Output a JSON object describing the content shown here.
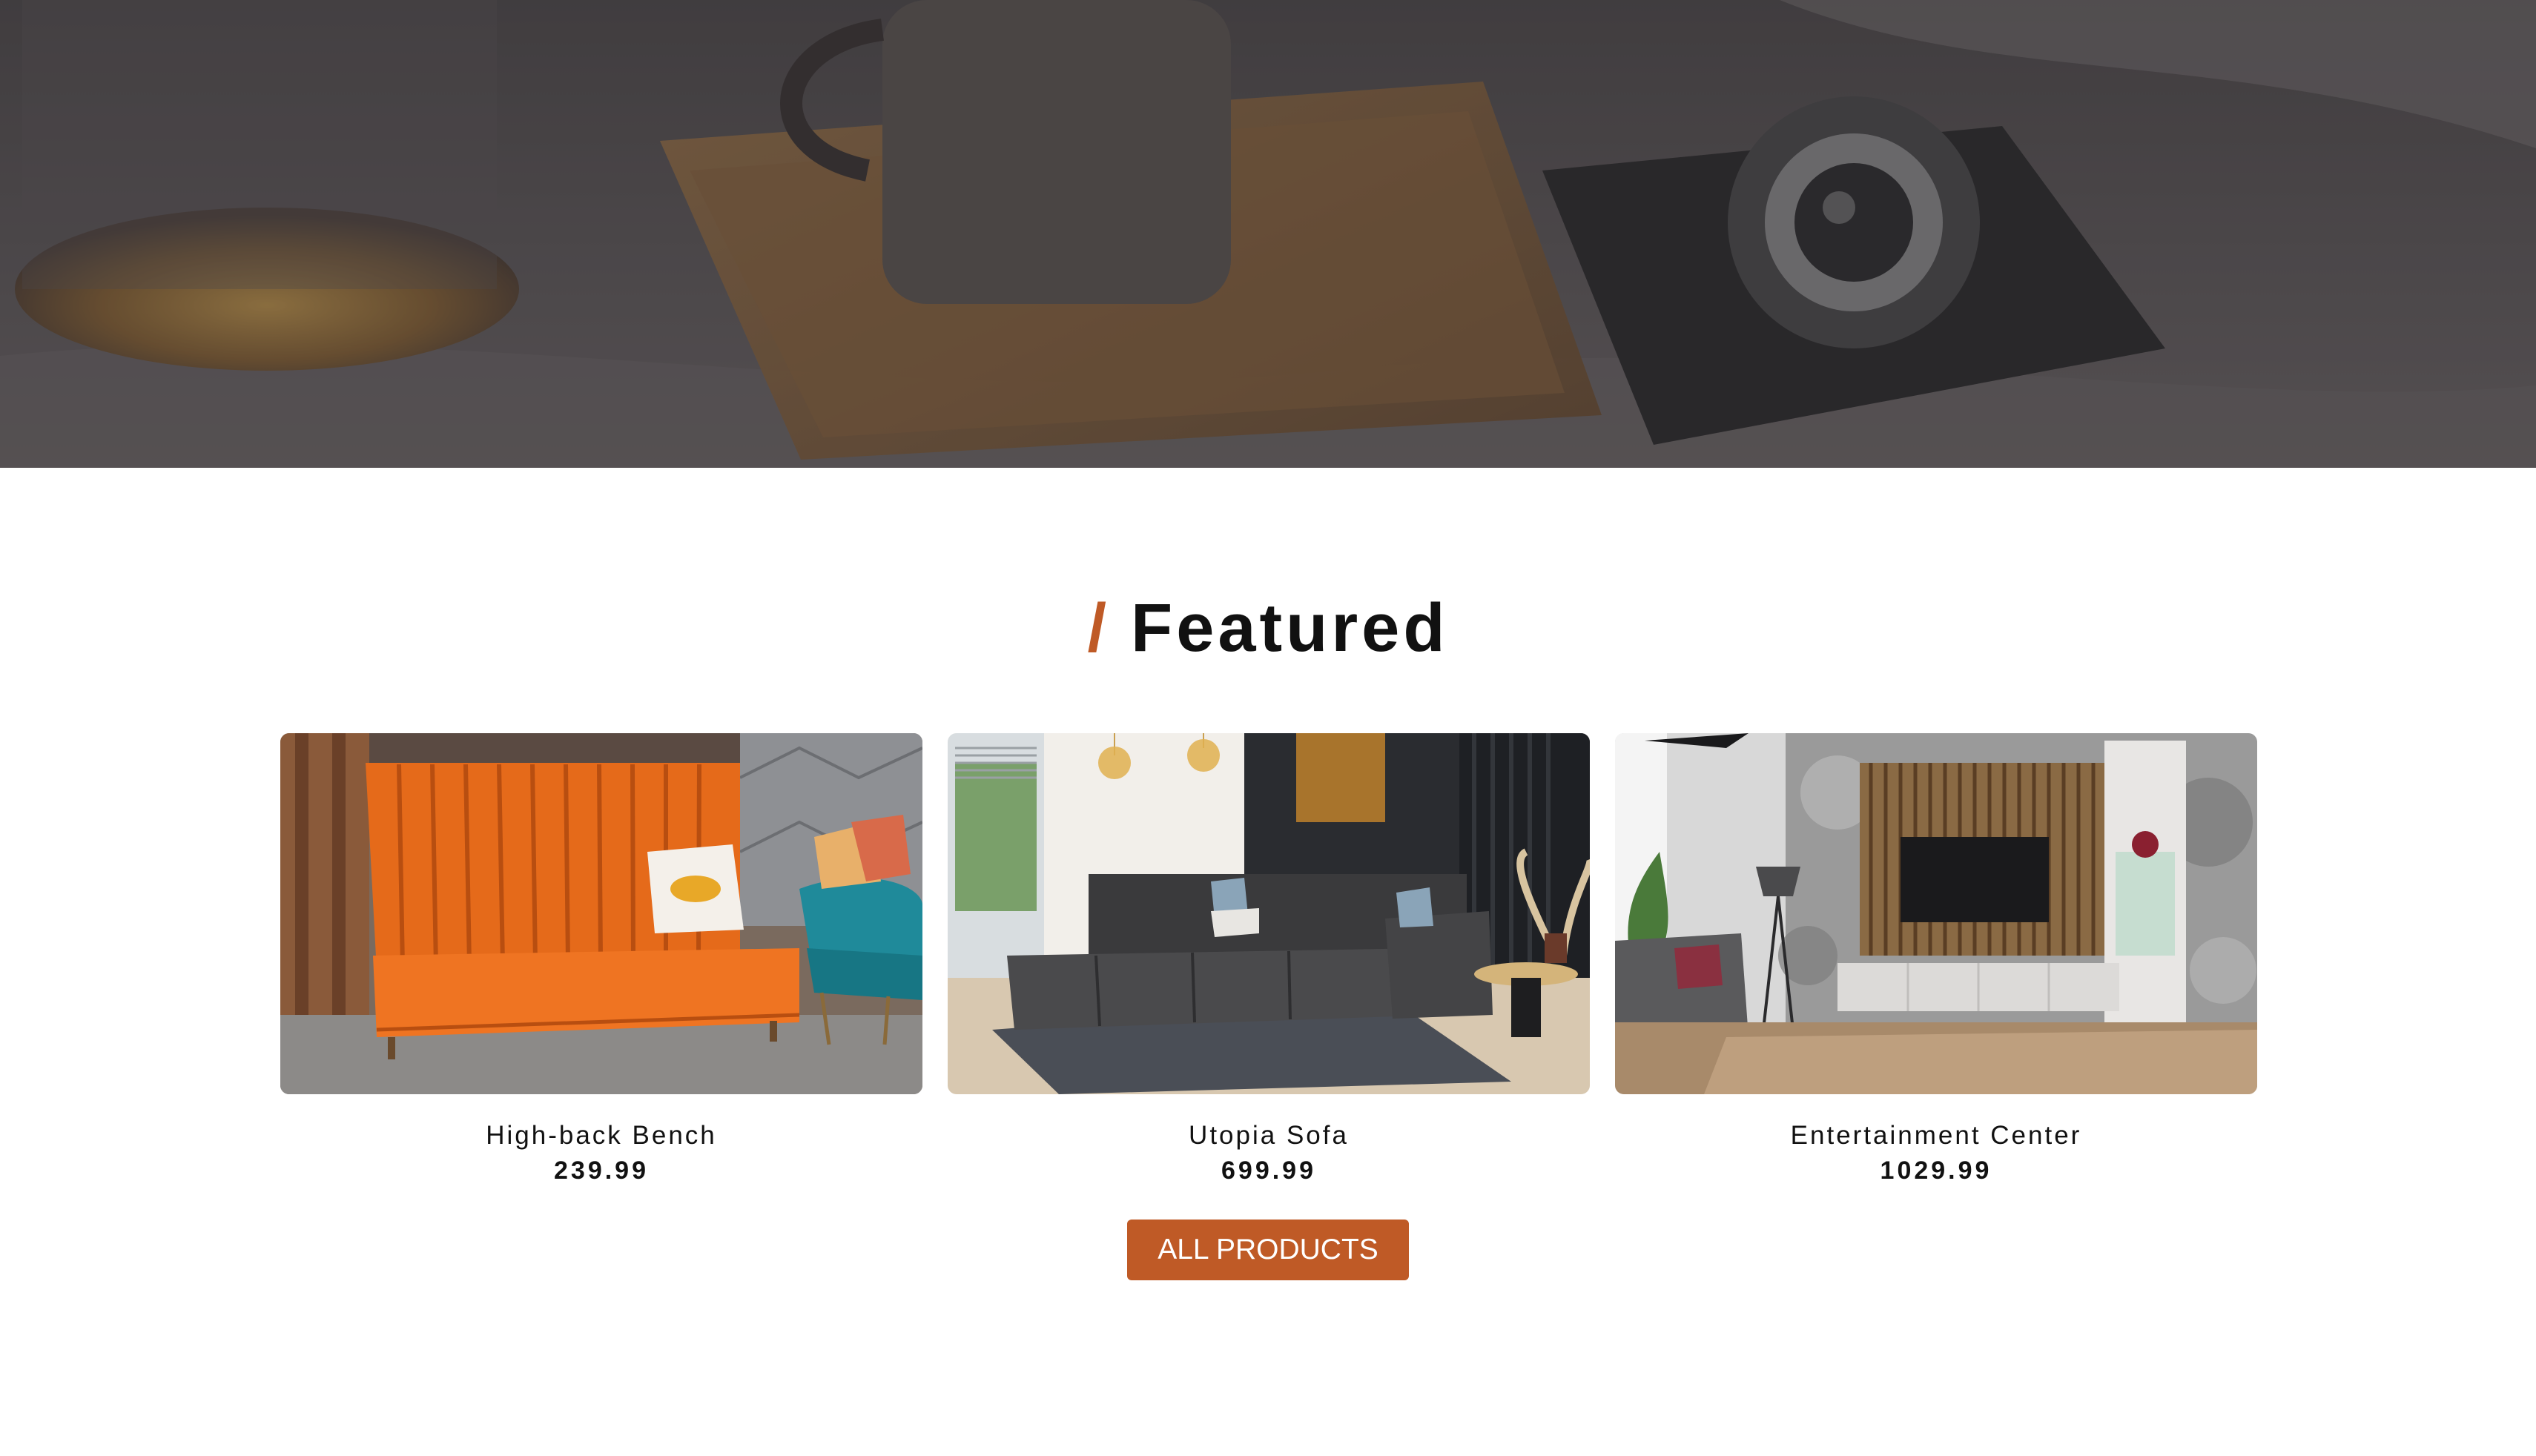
{
  "hero": {
    "image_icon": "hero-background-image"
  },
  "featured": {
    "slash": "/",
    "title": "Featured"
  },
  "products": [
    {
      "name": "High-back Bench",
      "price": "239.99",
      "icon": "bench-photo"
    },
    {
      "name": "Utopia Sofa",
      "price": "699.99",
      "icon": "sofa-photo"
    },
    {
      "name": "Entertainment Center",
      "price": "1029.99",
      "icon": "entertainment-center-photo"
    }
  ],
  "all_products_button": "ALL PRODUCTS",
  "colors": {
    "accent": "#bf5a26",
    "text": "#111111",
    "background": "#ffffff"
  }
}
